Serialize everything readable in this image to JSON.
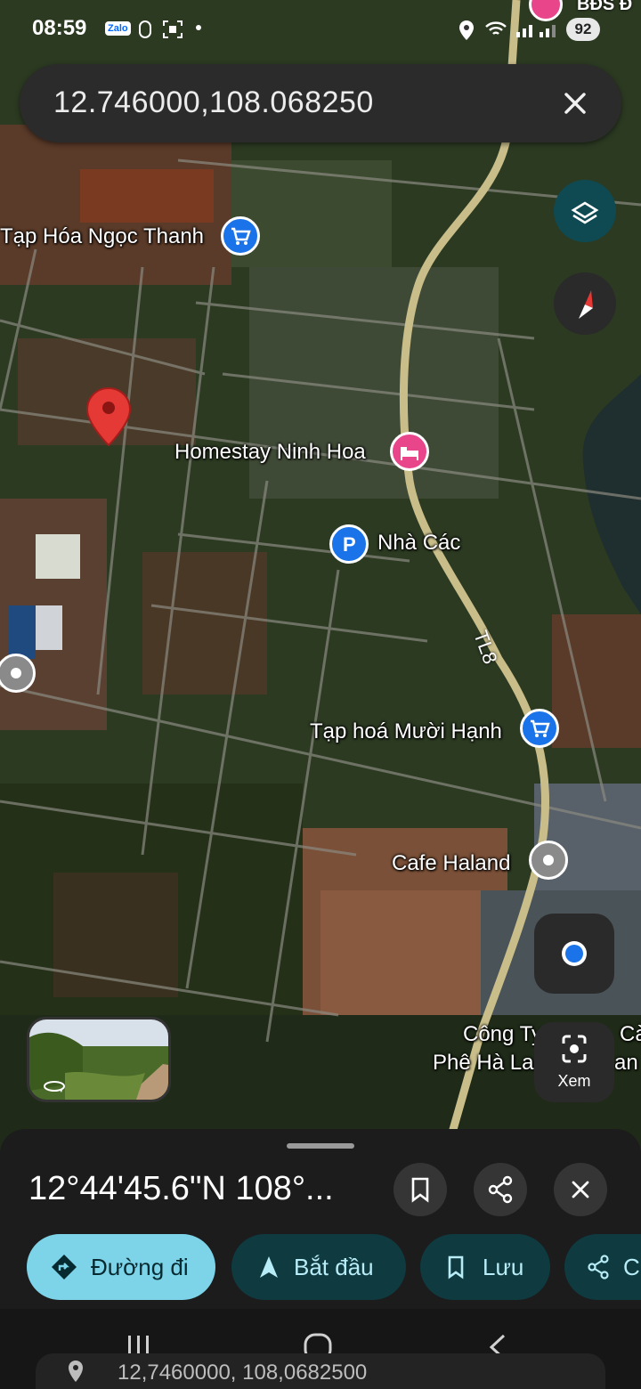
{
  "status_bar": {
    "time": "08:59",
    "app_icon_label": "Zalo",
    "battery": "92",
    "notif_text": "BĐS Đ"
  },
  "search": {
    "query": "12.746000,108.068250"
  },
  "map": {
    "pois": [
      {
        "label": "Tạp Hóa Ngọc Thanh",
        "type": "shopping-cart-icon",
        "color": "#1a73e8"
      },
      {
        "label": "Homestay Ninh Hoa",
        "type": "bed-icon",
        "color": "#e8458b"
      },
      {
        "label": "Nhà Các",
        "type": "parking-icon",
        "color": "#1a73e8"
      },
      {
        "label": "Tạp hoá Mười Hạnh",
        "type": "shopping-cart-icon",
        "color": "#1a73e8"
      },
      {
        "label": "Cafe Haland",
        "type": "pin-dot-icon",
        "color": "#888888"
      },
      {
        "label": "Công Ty",
        "type": "text",
        "color": "#ffffff"
      },
      {
        "label": "Phê Hà La",
        "type": "text",
        "color": "#ffffff"
      }
    ],
    "road_label": "TL8",
    "lens_label": "Xem",
    "fragment_1": "Cà",
    "fragment_2": "an"
  },
  "sheet": {
    "title": "12°44'45.6\"N 108°...",
    "chips": [
      {
        "label": "Đường đi",
        "icon": "directions-icon"
      },
      {
        "label": "Bắt đầu",
        "icon": "navigation-arrow-icon"
      },
      {
        "label": "Lưu",
        "icon": "bookmark-icon"
      },
      {
        "label": "C",
        "icon": "share-icon"
      }
    ]
  },
  "bottom": {
    "coords": "12,7460000, 108,0682500"
  },
  "colors": {
    "accent_chip": "#7dd3e8",
    "dark_chip": "#0f3a40",
    "pin_red": "#e53935"
  }
}
